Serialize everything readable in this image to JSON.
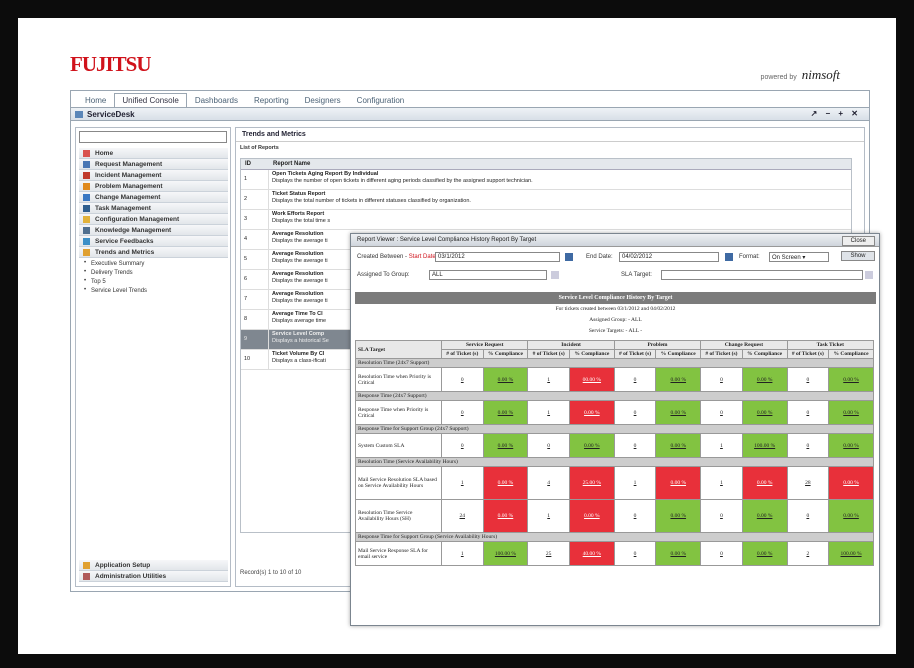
{
  "brand": {
    "logo": "FUJITSU",
    "powered_by": "powered by",
    "powered_brand": "nimsoft"
  },
  "tabs": [
    "Home",
    "Unified Console",
    "Dashboards",
    "Reporting",
    "Designers",
    "Configuration"
  ],
  "window": {
    "title": "ServiceDesk",
    "controls": "↗ − + ✕"
  },
  "sidebar": {
    "items": [
      "Home",
      "Request Management",
      "Incident Management",
      "Problem Management",
      "Change Management",
      "Task Management",
      "Configuration Management",
      "Knowledge Management",
      "Service Feedbacks",
      "Trends and Metrics"
    ],
    "subitems": [
      "Executive Summary",
      "Delivery Trends",
      "Top 5",
      "Service Level Trends"
    ],
    "bottom": [
      "Application Setup",
      "Administration Utilities"
    ]
  },
  "content": {
    "heading": "Trends and Metrics",
    "list_label": "List of Reports",
    "col_id": "ID",
    "col_name": "Report Name",
    "rows": [
      {
        "id": "1",
        "name": "Open Tickets Aging Report By Individual",
        "desc": "Displays the number of open tickets in different aging periods classified by the assigned support technician."
      },
      {
        "id": "2",
        "name": "Ticket Status Report",
        "desc": "Displays the total number of tickets in different statuses classified by organization."
      },
      {
        "id": "3",
        "name": "Work Efforts Report",
        "desc": "Displays the total time s"
      },
      {
        "id": "4",
        "name": "Average Resolution",
        "desc": "Displays the average ti"
      },
      {
        "id": "5",
        "name": "Average Resolution",
        "desc": "Displays the average ti"
      },
      {
        "id": "6",
        "name": "Average Resolution",
        "desc": "Displays the average ti"
      },
      {
        "id": "7",
        "name": "Average Resolution",
        "desc": "Displays the average ti"
      },
      {
        "id": "8",
        "name": "Average Time To Cl",
        "desc": "Displays average time"
      },
      {
        "id": "9",
        "name": "Service Level Comp",
        "desc": "Displays a historical Se"
      },
      {
        "id": "10",
        "name": "Ticket Volume By Cl",
        "desc": "Displays a class-ificati"
      }
    ],
    "footer": "Record(s) 1 to 10 of 10"
  },
  "viewer": {
    "title": "Report Viewer : Service Level Compliance History Report By Target",
    "close": "Close",
    "created_between_label": "Created Between -",
    "start_date_label": "Start Date:",
    "start_date": "03/1/2012",
    "end_date_label": "End Date:",
    "end_date": "04/02/2012",
    "format_label": "Format:",
    "format_value": "On Screen",
    "show_button": "Show",
    "assigned_group_label": "Assigned To Group:",
    "assigned_group_value": "ALL",
    "sla_target_label": "SLA Target:",
    "report_title": "Service Level Compliance History By Target",
    "info": [
      "For tickets created between 03/1/2012 and 04/02/2012",
      "Assigned Group: - ALL",
      "Service Targets: - ALL -"
    ],
    "col_target": "SLA Target",
    "groups": [
      "Service Request",
      "Incident",
      "Problem",
      "Change Request",
      "Task Ticket"
    ],
    "sub_count": "# of Ticket (s)",
    "sub_pct": "% Compliance",
    "sections": [
      {
        "name": "Resolution Time (24x7 Support)",
        "rows": [
          {
            "target": "Resolution Time when Priority is Critical",
            "cells": [
              [
                "0",
                "0.00 %",
                "g"
              ],
              [
                "1",
                "00.00 %",
                "r"
              ],
              [
                "0",
                "0.00 %",
                "g"
              ],
              [
                "0",
                "0.00 %",
                "g"
              ],
              [
                "0",
                "0.00 %",
                "g"
              ]
            ]
          }
        ]
      },
      {
        "name": "Response Time (24x7 Support)",
        "rows": [
          {
            "target": "Response Time when Priority is Critical",
            "cells": [
              [
                "0",
                "0.00 %",
                "g"
              ],
              [
                "1",
                "0.00 %",
                "r"
              ],
              [
                "0",
                "0.00 %",
                "g"
              ],
              [
                "0",
                "0.00 %",
                "g"
              ],
              [
                "0",
                "0.00 %",
                "g"
              ]
            ]
          }
        ]
      },
      {
        "name": "Response Time for Support Group (24x7 Support)",
        "rows": [
          {
            "target": "System Custom SLA",
            "cells": [
              [
                "0",
                "0.00 %",
                "g"
              ],
              [
                "0",
                "0.00 %",
                "g"
              ],
              [
                "0",
                "0.00 %",
                "g"
              ],
              [
                "1",
                "100.00 %",
                "g"
              ],
              [
                "0",
                "0.00 %",
                "g"
              ]
            ]
          }
        ]
      },
      {
        "name": "Resolution Time (Service Availability Hours)",
        "rows": [
          {
            "target": "Mail Service Resolution SLA based on Service Availability Hours",
            "cells": [
              [
                "1",
                "0.00 %",
                "r"
              ],
              [
                "4",
                "25.00 %",
                "r"
              ],
              [
                "1",
                "0.00 %",
                "r"
              ],
              [
                "1",
                "0.00 %",
                "r"
              ],
              [
                "28",
                "0.00 %",
                "r"
              ]
            ]
          },
          {
            "target": "Resolution Time Service Availability Hours (SH)",
            "cells": [
              [
                "24",
                "0.00 %",
                "r"
              ],
              [
                "1",
                "0.00 %",
                "r"
              ],
              [
                "0",
                "0.00 %",
                "g"
              ],
              [
                "0",
                "0.00 %",
                "g"
              ],
              [
                "0",
                "0.00 %",
                "g"
              ]
            ]
          }
        ]
      },
      {
        "name": "Response Time for Support Group (Service Availability Hours)",
        "rows": [
          {
            "target": "Mail Service Response SLA for email service",
            "cells": [
              [
                "1",
                "100.00 %",
                "g"
              ],
              [
                "25",
                "40.00 %",
                "r"
              ],
              [
                "0",
                "0.00 %",
                "g"
              ],
              [
                "0",
                "0.00 %",
                "g"
              ],
              [
                "2",
                "100.00 %",
                "g"
              ]
            ]
          }
        ]
      }
    ]
  }
}
